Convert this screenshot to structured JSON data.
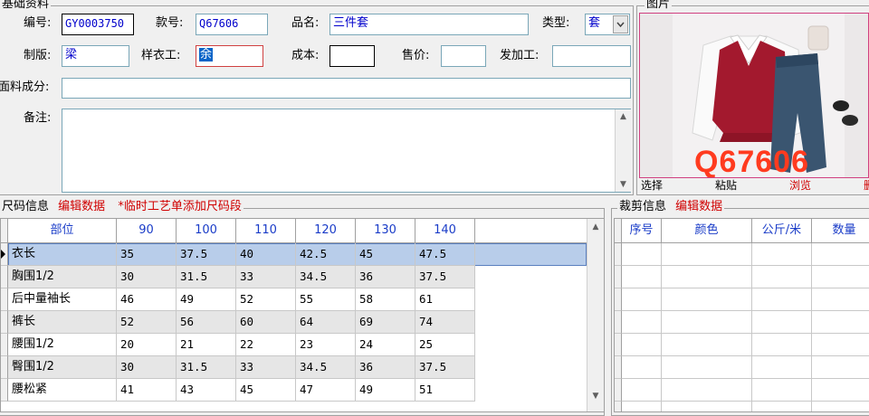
{
  "basic": {
    "title": "基础资料",
    "fields": {
      "code_label": "编号:",
      "code_value": "GY0003750",
      "style_label": "款号:",
      "style_value": "Q67606",
      "name_label": "品名:",
      "name_value": "三件套",
      "type_label": "类型:",
      "type_value": "套",
      "pattern_label": "制版:",
      "pattern_value": "梁",
      "sample_label": "样衣工:",
      "sample_value": "余",
      "cost_label": "成本:",
      "cost_value": "",
      "price_label": "售价:",
      "price_value": "",
      "process_label": "发加工:",
      "process_value": "",
      "fabric_label": "面料成分:",
      "fabric_value": "",
      "remark_label": "备注:",
      "remark_value": ""
    }
  },
  "picture": {
    "title": "图片",
    "watermark": "Q67606",
    "buttons": [
      "选择",
      "粘贴",
      "浏览",
      "删"
    ]
  },
  "size_info": {
    "title": "尺码信息",
    "edit_link": "编辑数据",
    "add_link": "*临时工艺单添加尺码段",
    "columns": [
      "部位",
      "90",
      "100",
      "110",
      "120",
      "130",
      "140"
    ],
    "rows": [
      [
        "衣长",
        "35",
        "37.5",
        "40",
        "42.5",
        "45",
        "47.5"
      ],
      [
        "胸围1/2",
        "30",
        "31.5",
        "33",
        "34.5",
        "36",
        "37.5"
      ],
      [
        "后中量袖长",
        "46",
        "49",
        "52",
        "55",
        "58",
        "61"
      ],
      [
        "裤长",
        "52",
        "56",
        "60",
        "64",
        "69",
        "74"
      ],
      [
        "腰围1/2",
        "20",
        "21",
        "22",
        "23",
        "24",
        "25"
      ],
      [
        "臀围1/2",
        "30",
        "31.5",
        "33",
        "34.5",
        "36",
        "37.5"
      ],
      [
        "腰松紧",
        "41",
        "43",
        "45",
        "47",
        "49",
        "51"
      ]
    ]
  },
  "cut_info": {
    "title": "裁剪信息",
    "edit_link": "编辑数据",
    "columns": [
      "序号",
      "颜色",
      "公斤/米",
      "数量"
    ]
  },
  "colors": {
    "selected_row": "#b8cdea",
    "header_text": "#1a3cc8",
    "link_red": "#d00000"
  }
}
